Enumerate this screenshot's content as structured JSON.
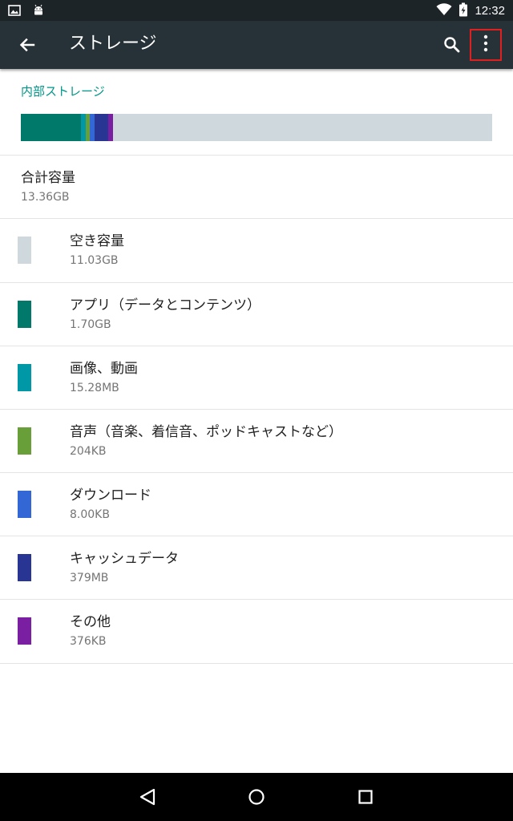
{
  "status_bar": {
    "time": "12:32",
    "left_icons": [
      "image-icon",
      "android-icon"
    ],
    "right_icons": [
      "wifi-icon",
      "battery-icon"
    ]
  },
  "toolbar": {
    "title": "ストレージ",
    "back_icon": "arrow-back-icon",
    "search_icon": "search-icon",
    "overflow_icon": "more-vert-icon"
  },
  "storage": {
    "section_title": "内部ストレージ",
    "bar_segments": [
      {
        "name": "アプリ（データとコンテンツ）",
        "fraction": 0.127,
        "color": "#00796b"
      },
      {
        "name": "画像、動画",
        "fraction": 0.01,
        "color": "#0097a7"
      },
      {
        "name": "音声（音楽、着信音、ポッドキャストなど）",
        "fraction": 0.01,
        "color": "#689f38"
      },
      {
        "name": "ダウンロード",
        "fraction": 0.01,
        "color": "#3367d6"
      },
      {
        "name": "キャッシュデータ",
        "fraction": 0.028,
        "color": "#283593"
      },
      {
        "name": "その他",
        "fraction": 0.011,
        "color": "#7b1fa2"
      }
    ],
    "bar_remainder_color": "#cfd8dc"
  },
  "total": {
    "label": "合計容量",
    "value": "13.36GB"
  },
  "items": [
    {
      "label": "空き容量",
      "size": "11.03GB",
      "color": "#cfd8dc"
    },
    {
      "label": "アプリ（データとコンテンツ）",
      "size": "1.70GB",
      "color": "#00796b"
    },
    {
      "label": "画像、動画",
      "size": "15.28MB",
      "color": "#0097a7"
    },
    {
      "label": "音声（音楽、着信音、ポッドキャストなど）",
      "size": "204KB",
      "color": "#689f38"
    },
    {
      "label": "ダウンロード",
      "size": "8.00KB",
      "color": "#3367d6"
    },
    {
      "label": "キャッシュデータ",
      "size": "379MB",
      "color": "#283593"
    },
    {
      "label": "その他",
      "size": "376KB",
      "color": "#7b1fa2"
    }
  ],
  "nav_bar": {
    "icons": [
      "back-triangle-icon",
      "home-circle-icon",
      "recents-square-icon"
    ]
  },
  "colors": {
    "toolbar": "#263238",
    "status_bar": "#1d2428",
    "accent": "#009688",
    "highlight_box": "#e02020"
  }
}
